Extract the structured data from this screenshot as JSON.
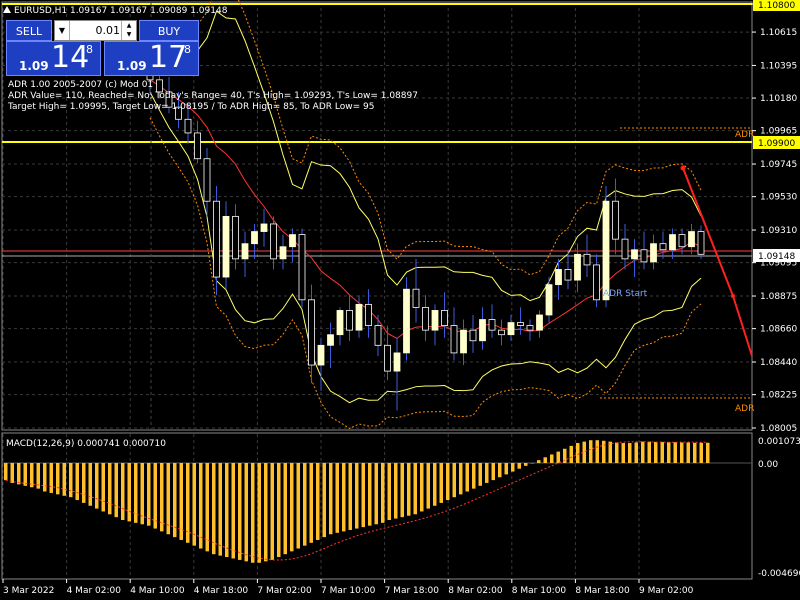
{
  "header": {
    "symbol_line": "EURUSD,H1  1.09167 1.09167 1.09089 1.09148",
    "adr_line1": "ADR 1.00 2005-2007 (c) Mod 01",
    "adr_line2": "ADR Value= 110, Reached= No, Today's Range= 40, T's High= 1.09293, T's Low= 1.08897",
    "adr_line3": "Target High= 1.09995, Target Low= 1.08195 / To ADR High= 85, To ADR Low= 95"
  },
  "trade_panel": {
    "sell_label": "SELL",
    "buy_label": "BUY",
    "lot_value": "0.01",
    "sell_small": "1.09",
    "sell_big": "14",
    "sell_sup": "8",
    "buy_small": "1.09",
    "buy_big": "17",
    "buy_sup": "8"
  },
  "chart_labels": {
    "adr_high_label": "ADR",
    "adr_low_label": "ADR",
    "adr_start_label": "ADR Start"
  },
  "price_axis": {
    "ticks": [
      "1.10800",
      "1.10615",
      "1.10395",
      "1.10180",
      "1.09965",
      "1.09745",
      "1.09530",
      "1.09310",
      "1.09095",
      "1.08875",
      "1.08660",
      "1.08440",
      "1.08225",
      "1.08005"
    ],
    "highlight_top": "1.10800",
    "highlight_adr": "1.09900",
    "current_price": "1.09148"
  },
  "macd": {
    "title": "MACD(12,26,9) 0.000741 0.000710",
    "top_value": "0.001073",
    "zero_label": "0.00",
    "bottom_value": "-0.004696",
    "bars": [
      -0.6,
      -0.7,
      -0.75,
      -0.8,
      -0.85,
      -0.9,
      -1.0,
      -1.05,
      -1.1,
      -1.15,
      -1.2,
      -1.3,
      -1.4,
      -1.5,
      -1.6,
      -1.7,
      -1.8,
      -1.9,
      -2.0,
      -2.05,
      -2.1,
      -2.15,
      -2.2,
      -2.3,
      -2.4,
      -2.5,
      -2.6,
      -2.7,
      -2.8,
      -2.9,
      -3.0,
      -3.1,
      -3.2,
      -3.25,
      -3.3,
      -3.35,
      -3.4,
      -3.45,
      -3.5,
      -3.5,
      -3.45,
      -3.4,
      -3.3,
      -3.2,
      -3.1,
      -3.0,
      -2.9,
      -2.8,
      -2.7,
      -2.6,
      -2.5,
      -2.45,
      -2.4,
      -2.35,
      -2.3,
      -2.25,
      -2.2,
      -2.15,
      -2.1,
      -2.0,
      -1.95,
      -1.9,
      -1.85,
      -1.8,
      -1.7,
      -1.6,
      -1.5,
      -1.4,
      -1.3,
      -1.2,
      -1.1,
      -1.0,
      -0.9,
      -0.8,
      -0.7,
      -0.6,
      -0.5,
      -0.4,
      -0.3,
      -0.2,
      -0.1,
      0.0,
      0.1,
      0.2,
      0.3,
      0.4,
      0.5,
      0.6,
      0.7,
      0.75,
      0.8,
      0.8,
      0.78,
      0.75,
      0.72,
      0.7,
      0.7,
      0.72,
      0.75,
      0.75,
      0.74,
      0.74,
      0.73,
      0.73,
      0.72,
      0.72,
      0.71,
      0.71,
      0.71
    ]
  },
  "time_axis": {
    "labels": [
      "3 Mar 2022",
      "4 Mar 02:00",
      "4 Mar 10:00",
      "4 Mar 18:00",
      "7 Mar 02:00",
      "7 Mar 10:00",
      "7 Mar 18:00",
      "8 Mar 02:00",
      "8 Mar 10:00",
      "8 Mar 18:00",
      "9 Mar 02:00"
    ]
  },
  "colors": {
    "background": "#000000",
    "grid": "#444444",
    "bull_candle": "#ffffcc",
    "bear_candle": "#000000",
    "wick": "#3b5bdb",
    "bands": "#ffff66",
    "ma_red": "#ff3333",
    "macd_bars": "#ffc02a",
    "adr_orange": "#ff8c00",
    "price_line_red": "#ff4040"
  },
  "chart_data": {
    "type": "candlestick",
    "symbol": "EURUSD",
    "timeframe": "H1",
    "ylim": [
      1.08005,
      1.108
    ],
    "candles": [
      [
        1.1035,
        1.1046,
        1.102,
        1.103
      ],
      [
        1.103,
        1.104,
        1.1018,
        1.1022
      ],
      [
        1.1022,
        1.1032,
        1.1008,
        1.1012
      ],
      [
        1.1012,
        1.1022,
        1.0998,
        1.1004
      ],
      [
        1.1004,
        1.1014,
        1.0988,
        1.0995
      ],
      [
        1.0995,
        1.1003,
        1.0975,
        1.0978
      ],
      [
        1.0978,
        1.0985,
        1.094,
        1.095
      ],
      [
        1.095,
        1.096,
        1.0888,
        1.09
      ],
      [
        1.09,
        1.095,
        1.0892,
        1.094
      ],
      [
        1.094,
        1.0948,
        1.0905,
        1.0912
      ],
      [
        1.0912,
        1.093,
        1.09,
        1.0922
      ],
      [
        1.0922,
        1.0935,
        1.0912,
        1.093
      ],
      [
        1.093,
        1.0945,
        1.092,
        1.0935
      ],
      [
        1.0935,
        1.094,
        1.0905,
        1.0912
      ],
      [
        1.0912,
        1.0928,
        1.0905,
        1.092
      ],
      [
        1.092,
        1.0932,
        1.091,
        1.0928
      ],
      [
        1.0928,
        1.0932,
        1.088,
        1.0885
      ],
      [
        1.0885,
        1.0895,
        1.083,
        1.0842
      ],
      [
        1.0842,
        1.086,
        1.0825,
        1.0855
      ],
      [
        1.0855,
        1.087,
        1.084,
        1.0862
      ],
      [
        1.0862,
        1.088,
        1.0855,
        1.0878
      ],
      [
        1.0878,
        1.0888,
        1.0858,
        1.0865
      ],
      [
        1.0865,
        1.0888,
        1.086,
        1.0882
      ],
      [
        1.0882,
        1.0892,
        1.086,
        1.0868
      ],
      [
        1.0868,
        1.0875,
        1.0848,
        1.0855
      ],
      [
        1.0855,
        1.0868,
        1.0832,
        1.0838
      ],
      [
        1.0838,
        1.086,
        1.0812,
        1.085
      ],
      [
        1.085,
        1.09,
        1.0845,
        1.0892
      ],
      [
        1.0892,
        1.0912,
        1.087,
        1.088
      ],
      [
        1.088,
        1.0888,
        1.0858,
        1.0865
      ],
      [
        1.0865,
        1.0882,
        1.0855,
        1.0878
      ],
      [
        1.0878,
        1.089,
        1.086,
        1.0868
      ],
      [
        1.0868,
        1.088,
        1.0845,
        1.085
      ],
      [
        1.085,
        1.0872,
        1.0842,
        1.0865
      ],
      [
        1.0865,
        1.0875,
        1.085,
        1.0858
      ],
      [
        1.0858,
        1.088,
        1.0852,
        1.0872
      ],
      [
        1.0872,
        1.0882,
        1.086,
        1.0865
      ],
      [
        1.0865,
        1.0872,
        1.0855,
        1.0862
      ],
      [
        1.0862,
        1.0875,
        1.0858,
        1.087
      ],
      [
        1.087,
        1.088,
        1.0862,
        1.0868
      ],
      [
        1.0868,
        1.0872,
        1.0858,
        1.0865
      ],
      [
        1.0865,
        1.0878,
        1.086,
        1.0875
      ],
      [
        1.0875,
        1.09,
        1.087,
        1.0895
      ],
      [
        1.0895,
        1.0912,
        1.0885,
        1.0905
      ],
      [
        1.0905,
        1.0918,
        1.0892,
        1.0898
      ],
      [
        1.0898,
        1.0922,
        1.089,
        1.0915
      ],
      [
        1.0915,
        1.0928,
        1.09,
        1.0908
      ],
      [
        1.0908,
        1.0915,
        1.088,
        1.0885
      ],
      [
        1.0885,
        1.096,
        1.088,
        1.095
      ],
      [
        1.095,
        1.0965,
        1.0915,
        1.0925
      ],
      [
        1.0925,
        1.0935,
        1.0905,
        1.0912
      ],
      [
        1.0912,
        1.0925,
        1.09,
        1.0918
      ],
      [
        1.0918,
        1.093,
        1.0905,
        1.091
      ],
      [
        1.091,
        1.0928,
        1.0905,
        1.0922
      ],
      [
        1.0922,
        1.093,
        1.0912,
        1.0918
      ],
      [
        1.0918,
        1.0932,
        1.0912,
        1.0928
      ],
      [
        1.0928,
        1.0932,
        1.0915,
        1.092
      ],
      [
        1.092,
        1.0935,
        1.0915,
        1.093
      ],
      [
        1.093,
        1.0934,
        1.0912,
        1.0915
      ]
    ]
  }
}
